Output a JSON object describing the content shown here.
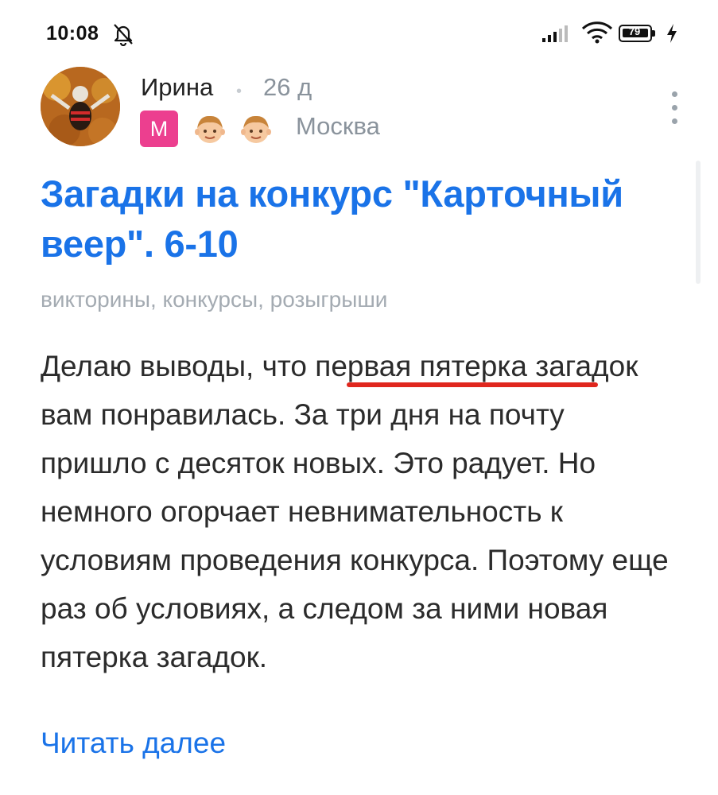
{
  "status_bar": {
    "time": "10:08",
    "battery": "79",
    "icons": [
      "bell-off-icon",
      "signal-icon",
      "wifi-icon",
      "battery-icon",
      "charging-icon"
    ]
  },
  "post": {
    "author": "Ирина",
    "separator": "•",
    "age": "26 д",
    "badge_letter": "М",
    "city": "Москва",
    "title": "Загадки на конкурс \"Карточный веер\". 6-10",
    "tags": "викторины, конкурсы, розыгрыши",
    "body": {
      "before": "Делаю выводы, что ",
      "highlight": "первая пятерка",
      "after": " загадок вам понравилась. За три дня на почту пришло с десяток новых. Это радует. Но немного огорчает невнимательность к условиям проведения конкурса. Поэтому еще раз об условиях, а следом за ними новая пятерка загадок."
    },
    "read_more": "Читать далее"
  },
  "colors": {
    "title": "#1a73e8",
    "link": "#1a73e8",
    "underline": "#e0271e",
    "badge": "#ec3f8f",
    "muted": "#8a939c"
  }
}
